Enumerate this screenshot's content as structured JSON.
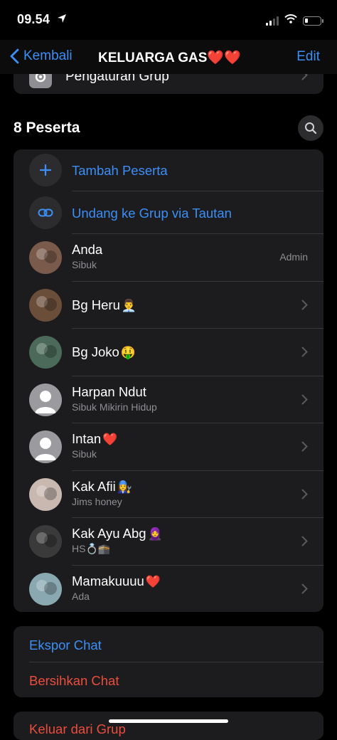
{
  "status_bar": {
    "time": "09.54",
    "battery_level": 0.15
  },
  "nav": {
    "back_label": "Kembali",
    "title": "KELUARGA GAS❤️❤️",
    "edit_label": "Edit"
  },
  "group_settings": {
    "label": "Pengaturan Grup"
  },
  "participants": {
    "header": "8 Peserta",
    "add_label": "Tambah Peserta",
    "invite_label": "Undang ke Grup via Tautan",
    "members": [
      {
        "name": "Anda",
        "status": "Sibuk",
        "badge": "Admin",
        "emoji": "",
        "avatar_color": "#7a5a4a"
      },
      {
        "name": "Bg Heru",
        "status": "",
        "badge": "",
        "emoji": "👨‍💼",
        "avatar_color": "#6b4e3a"
      },
      {
        "name": "Bg Joko",
        "status": "",
        "badge": "",
        "emoji": "🤑",
        "avatar_color": "#4b6a5a"
      },
      {
        "name": "Harpan Ndut",
        "status": "Sibuk Mikirin Hidup",
        "badge": "",
        "emoji": "",
        "avatar_color": "#9a9a9f"
      },
      {
        "name": "Intan",
        "status": "Sibuk",
        "badge": "",
        "emoji": "❤️",
        "avatar_color": "#9a9a9f"
      },
      {
        "name": "Kak Afii",
        "status": "Jims honey",
        "badge": "",
        "emoji": "👩‍🔧",
        "avatar_color": "#c8b8b0"
      },
      {
        "name": "Kak Ayu Abg",
        "status": "HS💍🕋",
        "badge": "",
        "emoji": "🧕",
        "avatar_color": "#3a3a3a"
      },
      {
        "name": "Mamakuuuu",
        "status": "Ada",
        "badge": "",
        "emoji": "❤️",
        "avatar_color": "#8aa8b0"
      }
    ]
  },
  "actions": {
    "export_label": "Ekspor Chat",
    "clear_label": "Bersihkan Chat",
    "exit_label": "Keluar dari Grup"
  },
  "colors": {
    "accent": "#3c8ff7",
    "destructive": "#eb4d3d",
    "card": "#1c1c1e"
  }
}
